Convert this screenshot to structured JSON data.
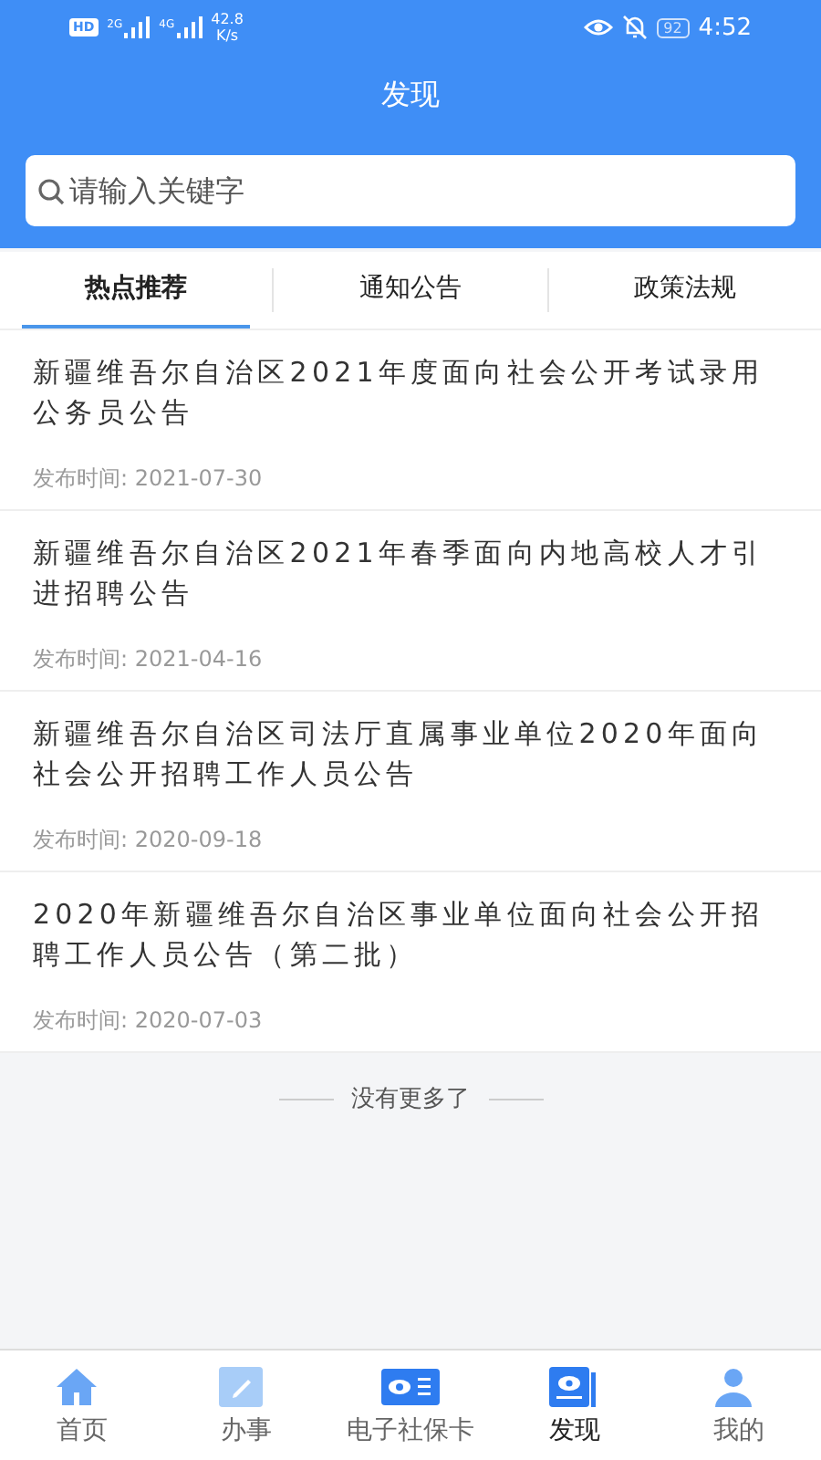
{
  "status_bar": {
    "badge": "HD",
    "signals": [
      {
        "label": "2G"
      },
      {
        "label": "4G"
      }
    ],
    "speed": "42.8",
    "speed_unit": "K/s",
    "battery": "92",
    "time": "4:52"
  },
  "header": {
    "title": "发现"
  },
  "search": {
    "placeholder": "请输入关键字"
  },
  "tabs": [
    {
      "label": "热点推荐",
      "selected": true
    },
    {
      "label": "通知公告",
      "selected": false
    },
    {
      "label": "政策法规",
      "selected": false
    }
  ],
  "articles": [
    {
      "title": "新疆维吾尔自治区2021年度面向社会公开考试录用公务员公告",
      "date": "发布时间: 2021-07-30"
    },
    {
      "title": "新疆维吾尔自治区2021年春季面向内地高校人才引进招聘公告",
      "date": "发布时间: 2021-04-16"
    },
    {
      "title": "新疆维吾尔自治区司法厅直属事业单位2020年面向社会公开招聘工作人员公告",
      "date": "发布时间: 2020-09-18"
    },
    {
      "title": "2020年新疆维吾尔自治区事业单位面向社会公开招聘工作人员公告（第二批）",
      "date": "发布时间: 2020-07-03"
    }
  ],
  "end_note": "没有更多了",
  "nav": [
    {
      "label": "首页",
      "selected": false
    },
    {
      "label": "办事",
      "selected": false
    },
    {
      "label": "电子社保卡",
      "selected": false
    },
    {
      "label": "发现",
      "selected": true
    },
    {
      "label": "我的",
      "selected": false
    }
  ]
}
